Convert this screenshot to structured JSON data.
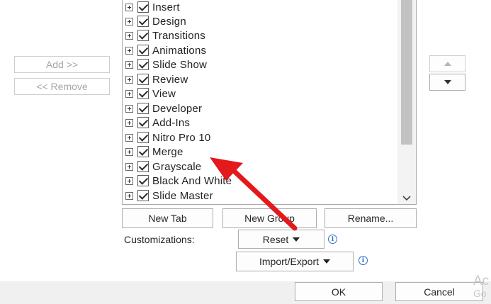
{
  "buttons": {
    "add": "Add >>",
    "remove": "<< Remove",
    "new_tab": "New Tab",
    "new_group": "New Group",
    "rename": "Rename...",
    "reset": "Reset",
    "import_export": "Import/Export",
    "ok": "OK",
    "cancel": "Cancel"
  },
  "customizations_label": "Customizations:",
  "tabs": [
    {
      "label": "Insert",
      "checked": true
    },
    {
      "label": "Design",
      "checked": true
    },
    {
      "label": "Transitions",
      "checked": true
    },
    {
      "label": "Animations",
      "checked": true
    },
    {
      "label": "Slide Show",
      "checked": true
    },
    {
      "label": "Review",
      "checked": true
    },
    {
      "label": "View",
      "checked": true
    },
    {
      "label": "Developer",
      "checked": true
    },
    {
      "label": "Add-Ins",
      "checked": true
    },
    {
      "label": "Nitro Pro 10",
      "checked": true
    },
    {
      "label": "Merge",
      "checked": true
    },
    {
      "label": "Grayscale",
      "checked": true
    },
    {
      "label": "Black And White",
      "checked": true
    },
    {
      "label": "Slide Master",
      "checked": true
    }
  ],
  "info_glyph": "i",
  "watermark": {
    "line1": "Ac",
    "line2": "Go"
  },
  "annotation": {
    "color": "#e3191c",
    "icon": "red-pointer-arrow"
  }
}
